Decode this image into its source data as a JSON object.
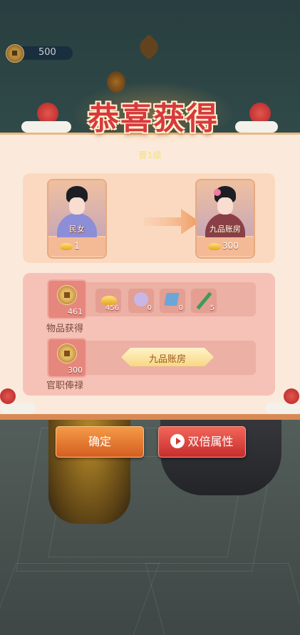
{
  "currency": {
    "amount": "500",
    "icon": "copper-coin-icon"
  },
  "title": "恭喜获得",
  "subtitle": "晋1级",
  "promotion": {
    "from": {
      "rank": "民女",
      "cost": "1"
    },
    "to": {
      "rank": "九品账房",
      "cost": "300"
    }
  },
  "rewards": {
    "items_label": "物品获得",
    "copper": "461",
    "items": [
      {
        "name": "gold-ingot-icon",
        "count": "456"
      },
      {
        "name": "fan-icon",
        "count": "0"
      },
      {
        "name": "book-icon",
        "count": "0"
      },
      {
        "name": "brush-icon",
        "count": "5"
      }
    ],
    "salary_label": "官职俸禄",
    "salary": "300",
    "salary_rank": "九品账房"
  },
  "buttons": {
    "confirm": "确定",
    "double": "双倍属性"
  },
  "colors": {
    "title": "#d8393d",
    "confirm": "#e7782f",
    "double": "#e04a40",
    "panel": "#fbeadb"
  }
}
